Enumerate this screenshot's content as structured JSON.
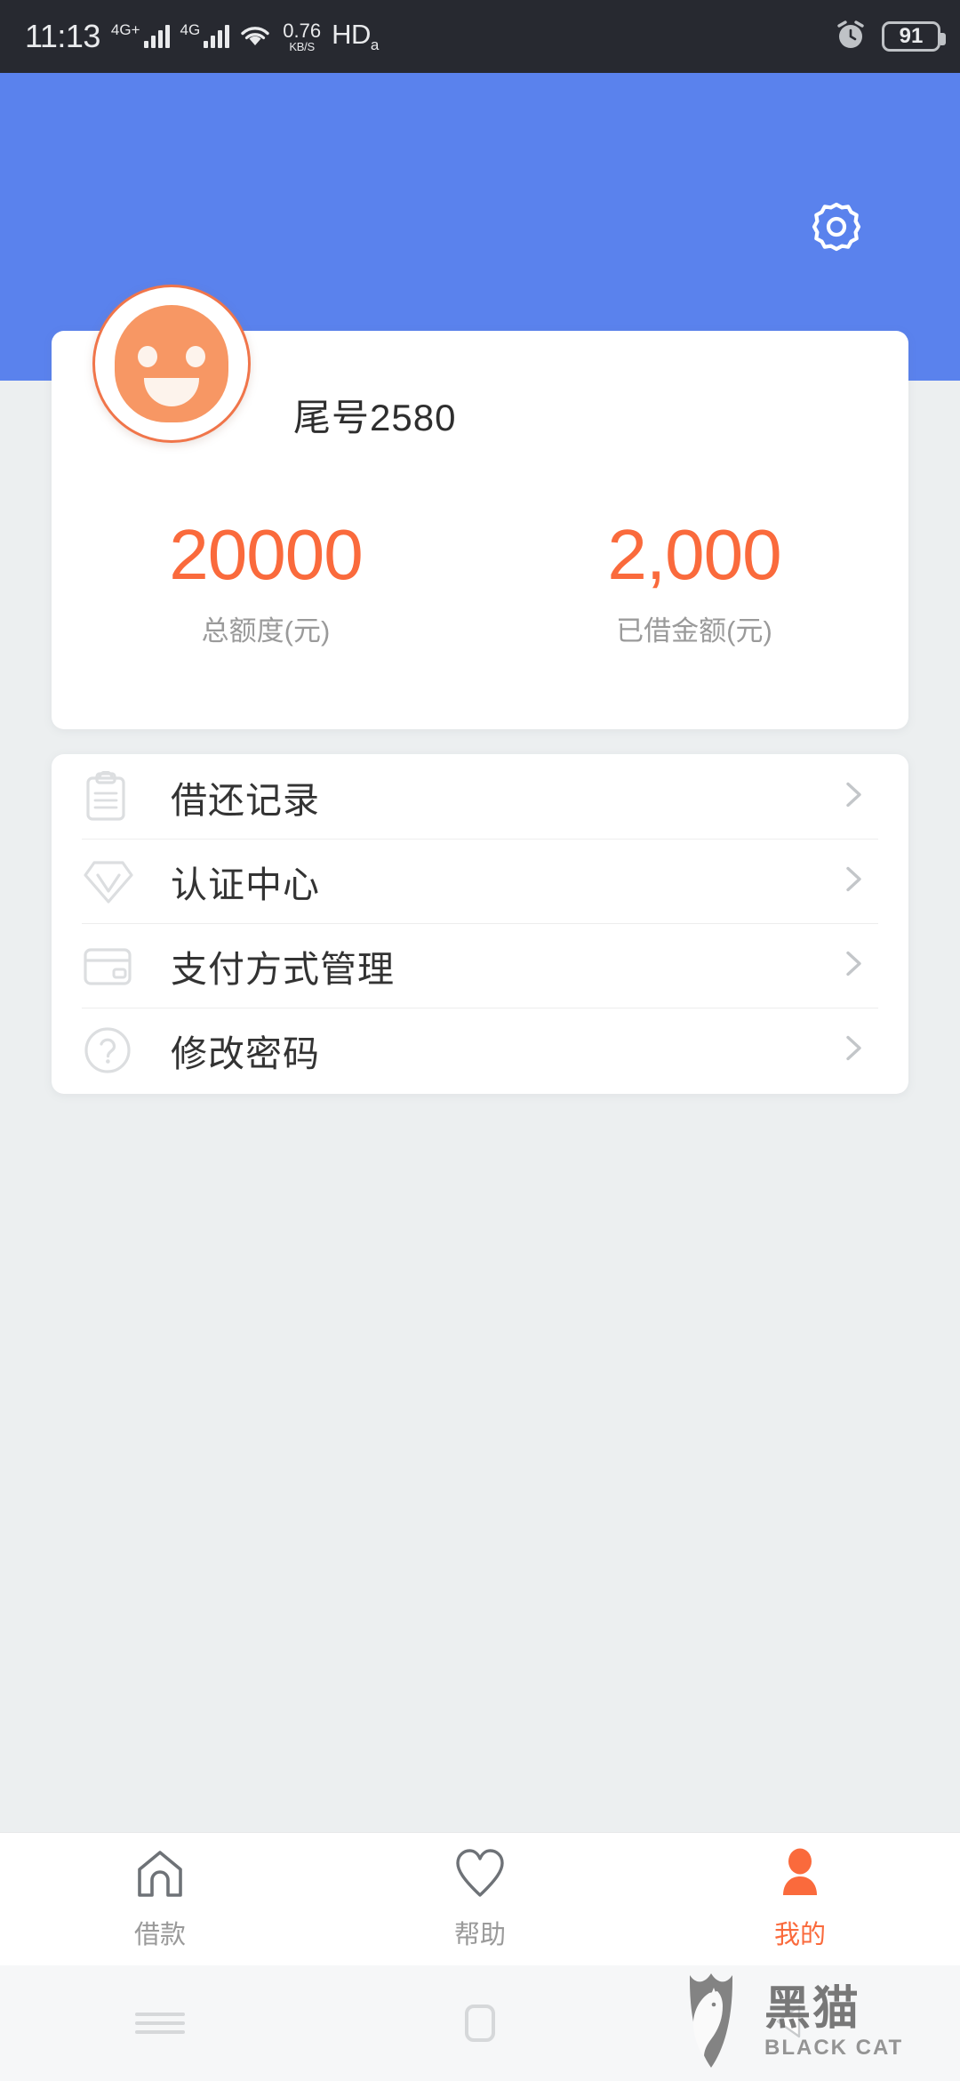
{
  "statusbar": {
    "time": "11:13",
    "network_1": "4G",
    "network_1_plus": "+",
    "network_2": "4G",
    "wifi_icon": "wifi-icon",
    "data_rate_value": "0.76",
    "data_rate_unit": "KB/S",
    "hd_label": "HD",
    "hd_sub": "a",
    "alarm_icon": "alarm-clock-icon",
    "battery_level": "91"
  },
  "header": {
    "background_color": "#5A82ED",
    "settings_icon": "gear-icon"
  },
  "profile": {
    "avatar_icon": "smiley-avatar",
    "account_label": "尾号2580",
    "stats": [
      {
        "value": "20000",
        "label": "总额度(元)"
      },
      {
        "value": "2,000",
        "label": "已借金额(元)"
      }
    ],
    "accent_color": "#FA6A3C"
  },
  "menu": {
    "items": [
      {
        "icon": "clipboard-icon",
        "label": "借还记录"
      },
      {
        "icon": "diamond-shield-icon",
        "label": "认证中心"
      },
      {
        "icon": "credit-card-icon",
        "label": "支付方式管理"
      },
      {
        "icon": "question-circle-icon",
        "label": "修改密码"
      }
    ],
    "chevron_icon": "chevron-right-icon"
  },
  "tabbar": {
    "tabs": [
      {
        "icon": "home-icon",
        "label": "借款",
        "active": false
      },
      {
        "icon": "heart-icon",
        "label": "帮助",
        "active": false
      },
      {
        "icon": "person-icon",
        "label": "我的",
        "active": true
      }
    ],
    "active_color": "#FA6A3C",
    "inactive_color": "#9A9A9A"
  },
  "sysnav": {
    "recents_icon": "recents-icon",
    "home_icon": "home-square-icon",
    "back_icon": "back-arrow-icon"
  },
  "watermark": {
    "logo_icon": "black-cat-shield-logo",
    "name_cn": "黑猫",
    "name_en": "BLACK CAT"
  }
}
